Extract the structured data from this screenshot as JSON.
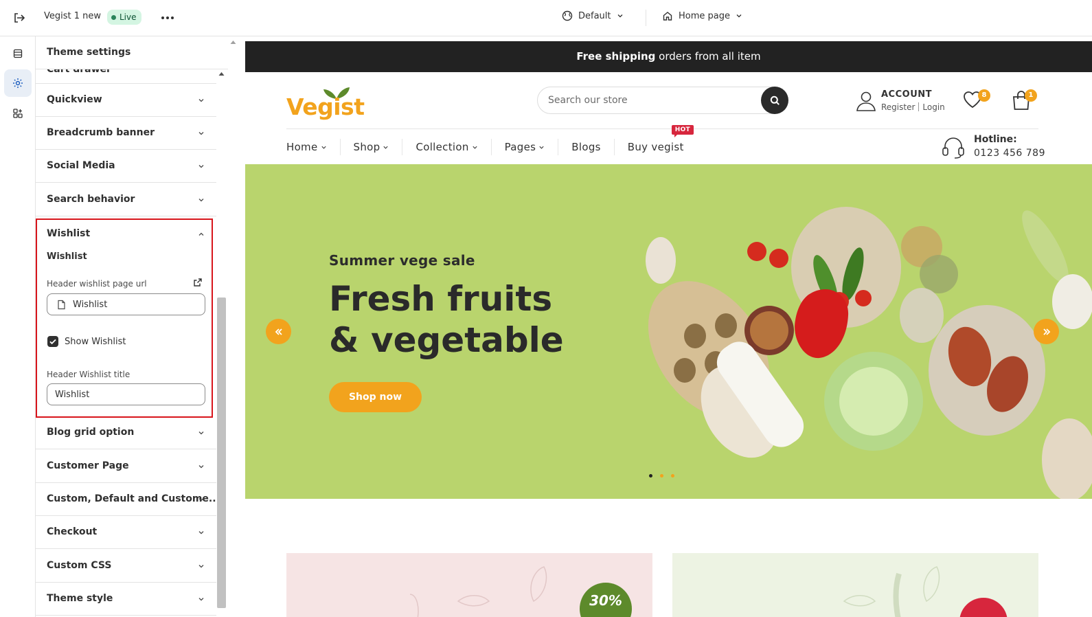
{
  "topbar": {
    "store_name": "Vegist 1 new",
    "status": "Live",
    "theme_label": "Default",
    "page_label": "Home page"
  },
  "panel": {
    "title": "Theme settings",
    "partial_item": "Cart drawer",
    "sections_before": [
      "Quickview",
      "Breadcrumb banner",
      "Social Media",
      "Search behavior"
    ],
    "wishlist": {
      "title": "Wishlist",
      "subheading": "Wishlist",
      "url_label": "Header wishlist page url",
      "url_value": "Wishlist",
      "checkbox_label": "Show Wishlist",
      "checkbox_checked": true,
      "title_label": "Header Wishlist title",
      "title_value": "Wishlist"
    },
    "sections_after": [
      "Blog grid option",
      "Customer Page",
      "Custom, Default and Custome...",
      "Checkout",
      "Custom CSS",
      "Theme style"
    ]
  },
  "store": {
    "announcement_bold": "Free shipping",
    "announcement_rest": " orders from all item",
    "logo_text": "Vegist",
    "search_placeholder": "Search our store",
    "account_title": "ACCOUNT",
    "register": "Register",
    "login": "Login",
    "wishlist_count": "8",
    "cart_count": "1",
    "nav": [
      {
        "label": "Home",
        "dropdown": true
      },
      {
        "label": "Shop",
        "dropdown": true
      },
      {
        "label": "Collection",
        "dropdown": true
      },
      {
        "label": "Pages",
        "dropdown": true
      },
      {
        "label": "Blogs",
        "dropdown": false
      },
      {
        "label": "Buy vegist",
        "dropdown": false
      }
    ],
    "hot_badge": "HOT",
    "hotline_label": "Hotline:",
    "hotline_number": "0123 456 789",
    "hero": {
      "subtitle": "Summer vege sale",
      "title_line1": "Fresh fruits",
      "title_line2": "& vegetable",
      "button": "Shop now",
      "slide_count": 3,
      "active_slide": 1
    },
    "promo_badge": "30%"
  },
  "colors": {
    "accent": "#f2a31d",
    "hero_bg": "#b9d46d",
    "highlight_border": "#d8141b",
    "announcement_bg": "#222222"
  }
}
